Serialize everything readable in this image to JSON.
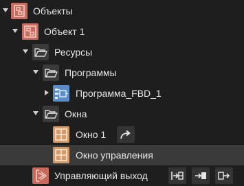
{
  "colors": {
    "background": "#1e1e1e",
    "selected_row": "#3a3a3a",
    "object_icon": "#c96b5c",
    "folder_icon_bg": "#3a3a3a",
    "program_icon": "#5b8dc8",
    "window_icon": "#d49a6a",
    "action_bg": "#343434"
  },
  "tree": {
    "root": {
      "label": "Объекты",
      "icon": "object-root-icon"
    },
    "object1": {
      "label": "Объект 1",
      "icon": "object-icon"
    },
    "resources": {
      "label": "Ресурсы",
      "icon": "folder-icon"
    },
    "programs": {
      "label": "Программы",
      "icon": "folder-icon"
    },
    "program_fbd": {
      "label": "Программа_FBD_1",
      "icon": "fbd-program-icon"
    },
    "windows": {
      "label": "Окна",
      "icon": "folder-icon"
    },
    "window1": {
      "label": "Окно 1",
      "icon": "window-icon",
      "action_icon": "redirect-arrow-icon"
    },
    "control_window": {
      "label": "Окно управления",
      "icon": "window-icon",
      "selected": true
    },
    "control_output": {
      "label": "Управляющий выход",
      "icon": "control-output-icon",
      "actions": [
        "insert-block-icon",
        "input-arrow-icon",
        "output-arrow-icon"
      ]
    }
  }
}
